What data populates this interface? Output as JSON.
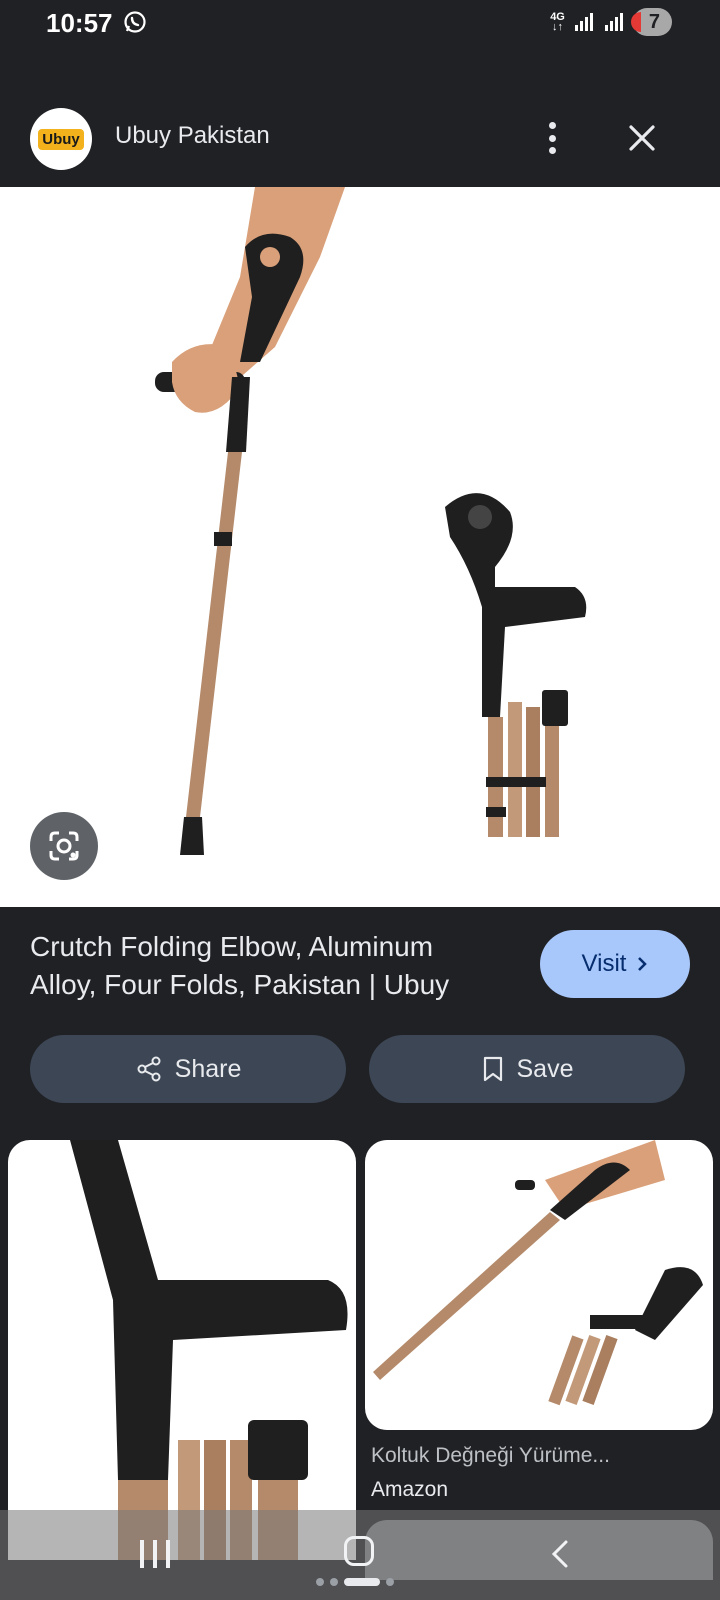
{
  "status": {
    "time": "10:57",
    "network": "4G",
    "battery_badge": "7",
    "icons": [
      "whatsapp-icon",
      "signal-icon",
      "signal-icon"
    ]
  },
  "header": {
    "logo_text": "Ubuy",
    "site_name": "Ubuy Pakistan",
    "icons": [
      "more-vert-icon",
      "close-icon"
    ]
  },
  "main_image": {
    "lens_icon": "google-lens-icon"
  },
  "result": {
    "title": "Crutch Folding Elbow, Aluminum Alloy, Four Folds, Pakistan | Ubuy",
    "visit_label": "Visit",
    "share_label": "Share",
    "save_label": "Save"
  },
  "related": [
    {
      "caption": "",
      "source": ""
    },
    {
      "caption": "Koltuk Değneği Yürüme...",
      "source": "Amazon"
    }
  ],
  "colors": {
    "background": "#202124",
    "visit_button": "#a8c7fa",
    "action_button": "#3c4655",
    "crutch_metal": "#b48a6a",
    "crutch_grip": "#1f1f1f"
  }
}
